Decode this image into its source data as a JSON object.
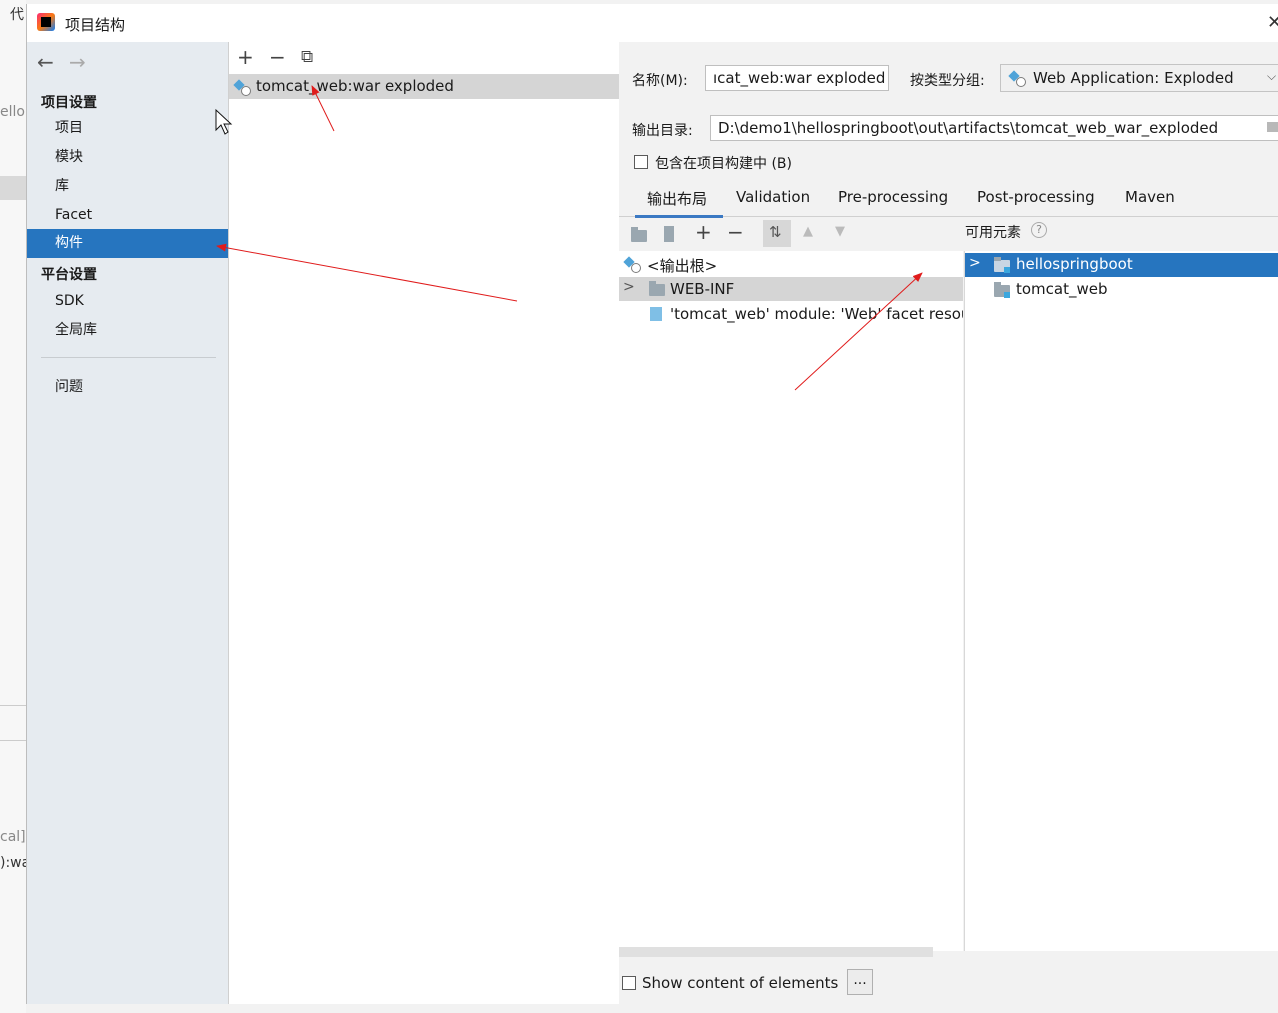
{
  "background": {
    "fragments": [
      "代",
      "ello",
      "cal]",
      "):wa"
    ]
  },
  "window": {
    "title": "项目结构",
    "close_glyph": "✕"
  },
  "sidebar": {
    "back_glyph": "←",
    "forward_glyph": "→",
    "section_project": "项目设置",
    "project_items": [
      "项目",
      "模块",
      "库",
      "Facet",
      "构件"
    ],
    "selected_item": "构件",
    "section_platform": "平台设置",
    "platform_items": [
      "SDK",
      "全局库"
    ],
    "problems": "问题"
  },
  "artifacts": {
    "toolbar": {
      "add": "+",
      "remove": "−",
      "copy": "⧉"
    },
    "items": [
      {
        "label": "tomcat_web:war exploded",
        "icon": "war-exploded-icon"
      }
    ]
  },
  "details": {
    "name_label": "名称(M):",
    "name_value": "ıcat_web:war exploded",
    "type_label": "按类型分组:",
    "type_value": "Web Application: Exploded",
    "output_label": "输出目录:",
    "output_value": "D:\\demo1\\hellospringboot\\out\\artifacts\\tomcat_web_war_exploded",
    "include_in_build": "包含在项目构建中 (B)",
    "include_checked": false,
    "tabs": [
      "输出布局",
      "Validation",
      "Pre-processing",
      "Post-processing",
      "Maven"
    ],
    "active_tab": "输出布局"
  },
  "layout": {
    "toolbar_icons": [
      "new-folder-icon",
      "archive-icon",
      "add-dropdown-icon",
      "remove-icon",
      "sort-icon",
      "move-up-icon",
      "move-down-icon"
    ],
    "tree": [
      {
        "label": "<输出根>",
        "icon": "output-root-icon",
        "depth": 0
      },
      {
        "label": "WEB-INF",
        "icon": "folder-icon",
        "depth": 1,
        "expandable": true
      },
      {
        "label": "'tomcat_web' module: 'Web' facet resou",
        "icon": "web-facet-icon",
        "depth": 1
      }
    ]
  },
  "available": {
    "header": "可用元素",
    "help_glyph": "?",
    "items": [
      {
        "label": "hellospringboot",
        "selected": true,
        "expandable": true
      },
      {
        "label": "tomcat_web",
        "selected": false,
        "expandable": false
      }
    ]
  },
  "footer": {
    "show_content": "Show content of elements",
    "show_content_checked": false,
    "more_button": "..."
  },
  "colors": {
    "selection": "#2675bf",
    "sidebar_bg": "#e6ebf0",
    "annotation_arrow": "#e01b1b"
  }
}
